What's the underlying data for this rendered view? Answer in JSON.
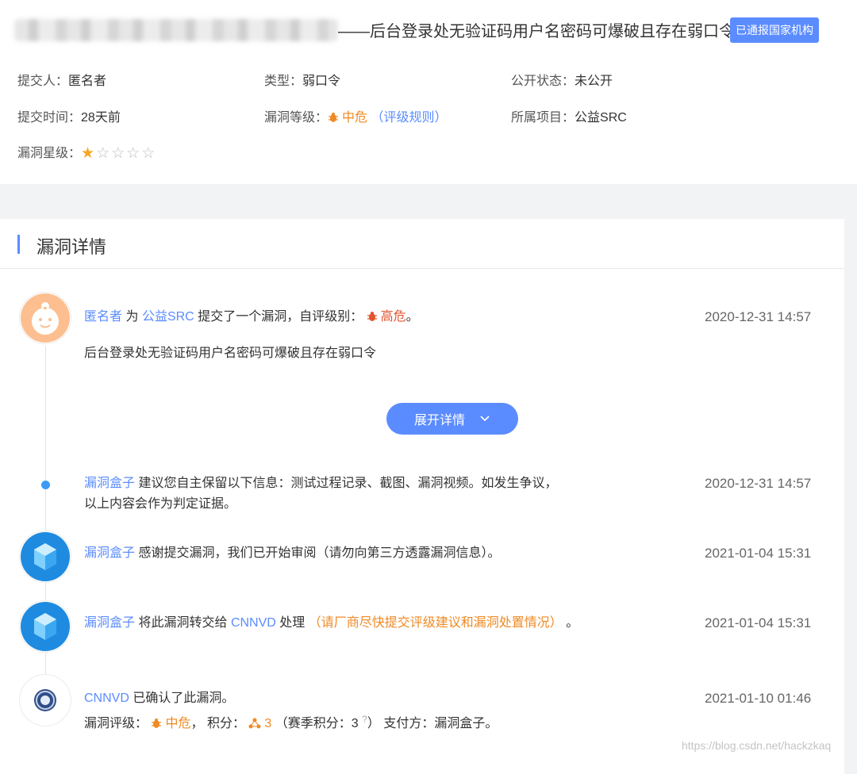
{
  "header": {
    "title": "——后台登录处无验证码用户名密码可爆破且存在弱口令",
    "badge": "已通报国家机构"
  },
  "meta": {
    "submitter_label": "提交人：",
    "submitter": "匿名者",
    "type_label": "类型：",
    "type": "弱口令",
    "public_label": "公开状态：",
    "public": "未公开",
    "time_label": "提交时间：",
    "time": "28天前",
    "level_label": "漏洞等级：",
    "level": "中危",
    "level_rule": "（评级规则）",
    "project_label": "所属项目：",
    "project": "公益SRC",
    "star_label": "漏洞星级：",
    "stars_filled": 1,
    "stars_total": 5
  },
  "detail": {
    "section_title": "漏洞详情",
    "expand_label": "展开详情",
    "items": [
      {
        "actor": "匿名者",
        "text1": "为",
        "target": "公益SRC",
        "text2": "提交了一个漏洞，自评级别：",
        "level": "高危",
        "end": "。",
        "summary": "后台登录处无验证码用户名密码可爆破且存在弱口令",
        "time": "2020-12-31 14:57"
      },
      {
        "actor": "漏洞盒子",
        "line1": "建议您自主保留以下信息：测试过程记录、截图、漏洞视频。如发生争议，",
        "line2": "以上内容会作为判定证据。",
        "time": "2020-12-31 14:57"
      },
      {
        "actor": "漏洞盒子",
        "text": "感谢提交漏洞，我们已开始审阅（请勿向第三方透露漏洞信息）。",
        "time": "2021-01-04 15:31"
      },
      {
        "actor": "漏洞盒子",
        "text1": "将此漏洞转交给",
        "target": "CNNVD",
        "text2": "处理",
        "note": "（请厂商尽快提交评级建议和漏洞处置情况）",
        "end": "。",
        "time": "2021-01-04 15:31"
      },
      {
        "actor": "CNNVD",
        "text": "已确认了此漏洞。",
        "rate_label": "漏洞评级：",
        "rate": "中危",
        "sep": "，",
        "score_label": "积分：",
        "score": "3",
        "season_label": "（赛季积分：",
        "season": "3",
        "season_q": "?",
        "season_end": "）",
        "payer": "支付方：漏洞盒子。",
        "time": "2021-01-10 01:46"
      }
    ]
  },
  "watermark": "https://blog.csdn.net/hackzkaq",
  "colors": {
    "accent": "#5b8cff",
    "orange": "#f08a24",
    "red": "#e2552f"
  }
}
